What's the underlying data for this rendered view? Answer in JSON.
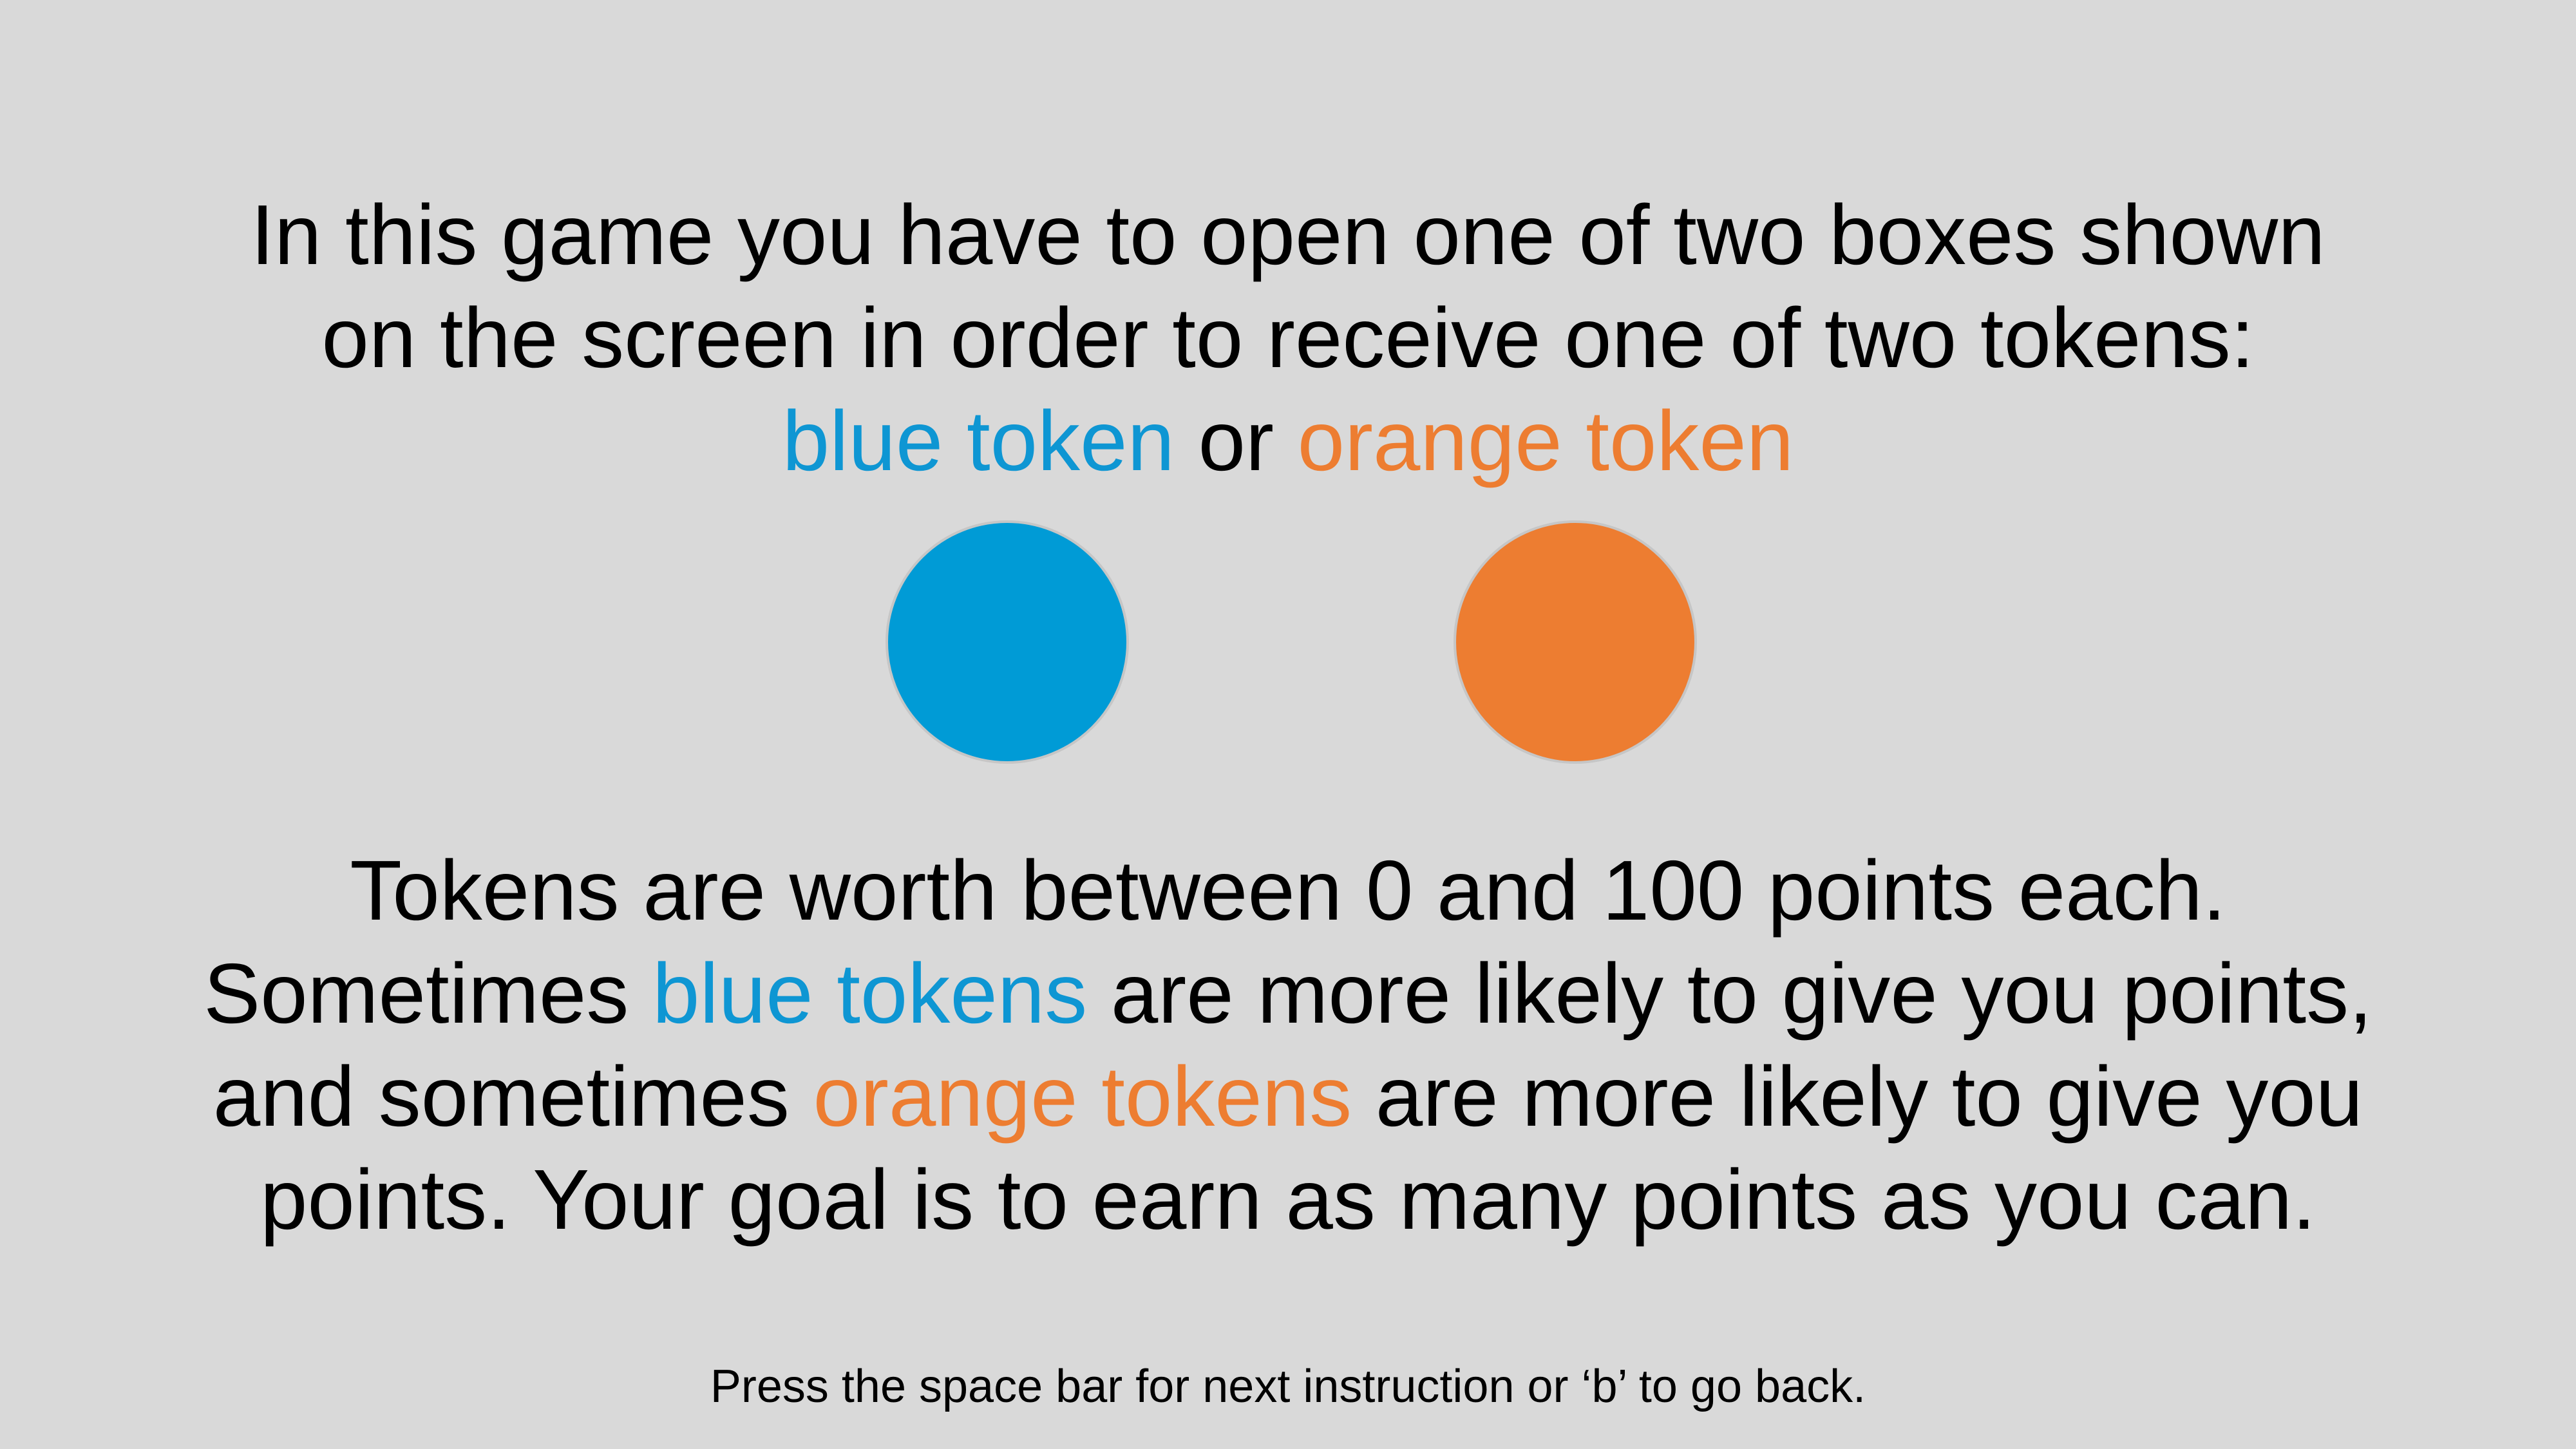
{
  "colors": {
    "background": "#d9d9d9",
    "text": "#000000",
    "blue": "#009bd6",
    "orange": "#ed7d31"
  },
  "intro": {
    "line1": "In this game you have to open one of two boxes shown",
    "line2": "on the screen in order to receive one of two tokens:",
    "blue_token": "blue token",
    "or": " or ",
    "orange_token": "orange token"
  },
  "tokens": [
    {
      "name": "blue token",
      "color": "#009bd6"
    },
    {
      "name": "orange token",
      "color": "#ed7d31"
    }
  ],
  "body": {
    "line1": "Tokens are worth between 0 and 100 points each.",
    "line2_pre": "Sometimes ",
    "line2_blue": "blue tokens",
    "line2_post": " are more likely to give you points,",
    "line3_pre": "and sometimes ",
    "line3_orange": "orange tokens",
    "line3_post": " are more likely to give you",
    "line4": "points. Your goal is to earn as many points as you can."
  },
  "footer": {
    "instruction": "Press the space bar for next instruction or ‘b’ to go back."
  }
}
